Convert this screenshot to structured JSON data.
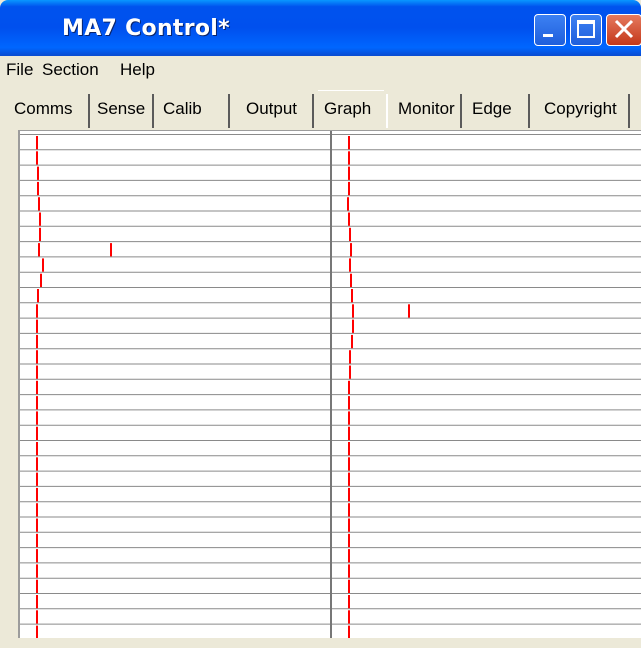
{
  "window": {
    "title": "MA7 Control*"
  },
  "menu": [
    "File",
    "Section",
    "Help"
  ],
  "tabs": [
    {
      "label": "Comms"
    },
    {
      "label": "Sense"
    },
    {
      "label": "Calib"
    },
    {
      "label": "Output"
    },
    {
      "label": "Graph",
      "active": true
    },
    {
      "label": "Monitor"
    },
    {
      "label": "Edge"
    },
    {
      "label": "Copyright"
    }
  ],
  "graph": {
    "row_count": 33,
    "columns": 2,
    "marker_color": "#ff0000",
    "grid_color": "#8a8a8a",
    "left_markers": [
      0,
      0,
      1,
      1,
      2,
      3,
      3,
      2,
      6,
      4,
      1,
      0,
      0,
      0,
      0,
      0,
      0,
      0,
      0,
      0,
      0,
      0,
      0,
      0,
      0,
      0,
      0,
      0,
      0,
      0,
      0,
      0,
      0
    ],
    "left_extra": {
      "row": 7,
      "offset": 19
    },
    "right_markers": [
      0,
      0,
      0,
      0,
      -1,
      0,
      1,
      2,
      1,
      2,
      3,
      4,
      4,
      3,
      1,
      1,
      0,
      0,
      0,
      0,
      0,
      0,
      0,
      0,
      0,
      0,
      0,
      0,
      0,
      0,
      0,
      0,
      0
    ],
    "right_extra": {
      "row": 11,
      "offset": 19
    }
  }
}
